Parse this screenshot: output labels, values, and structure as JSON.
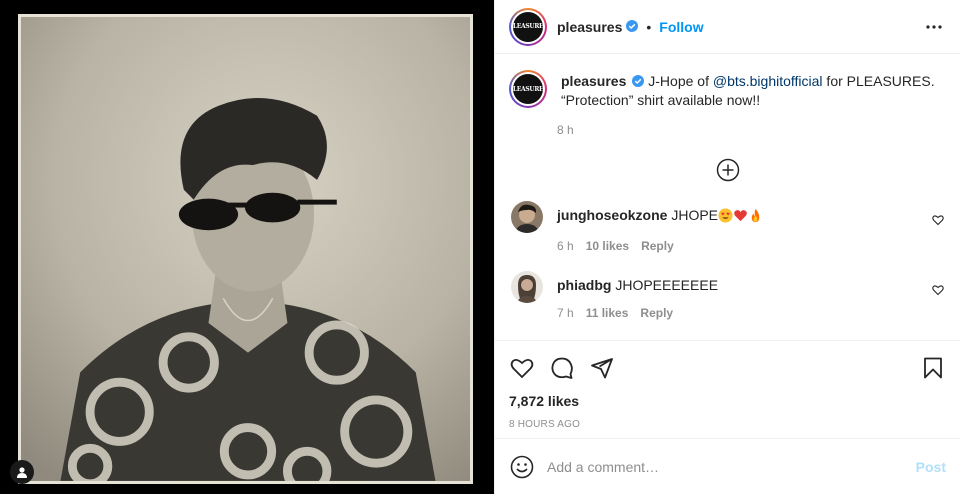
{
  "post": {
    "username": "pleasures",
    "logo_text": "PLEASURES",
    "follow_label": "Follow",
    "dot": "•",
    "caption_prefix": "J-Hope of ",
    "caption_mention": "@bts.bighitofficial",
    "caption_suffix": " for PLEASURES. “Protection” shirt available now!!",
    "caption_time": "8 h",
    "likes": "7,872 likes",
    "timestamp": "8 HOURS AGO"
  },
  "comments": [
    {
      "username": "junghoseokzone",
      "text": "JHOPE",
      "emojis": [
        "heart-eyes",
        "red-heart",
        "fire"
      ],
      "time": "6 h",
      "likes": "10 likes",
      "reply": "Reply"
    },
    {
      "username": "phiadbg",
      "text": "JHOPEEEEEEE",
      "emojis": [],
      "time": "7 h",
      "likes": "11 likes",
      "reply": "Reply"
    }
  ],
  "composer": {
    "placeholder": "Add a comment…",
    "post_label": "Post"
  },
  "icons": [
    "user-tag-icon",
    "verified-badge-icon",
    "more-options-icon",
    "load-more-comments-icon",
    "heart-icon",
    "comment-icon",
    "share-icon",
    "bookmark-icon",
    "emoji-icon"
  ],
  "colors": {
    "accent": "#0095f6",
    "muted": "#8e8e8e",
    "verified": "#3897f0",
    "post_disabled": "#b2dffc"
  }
}
